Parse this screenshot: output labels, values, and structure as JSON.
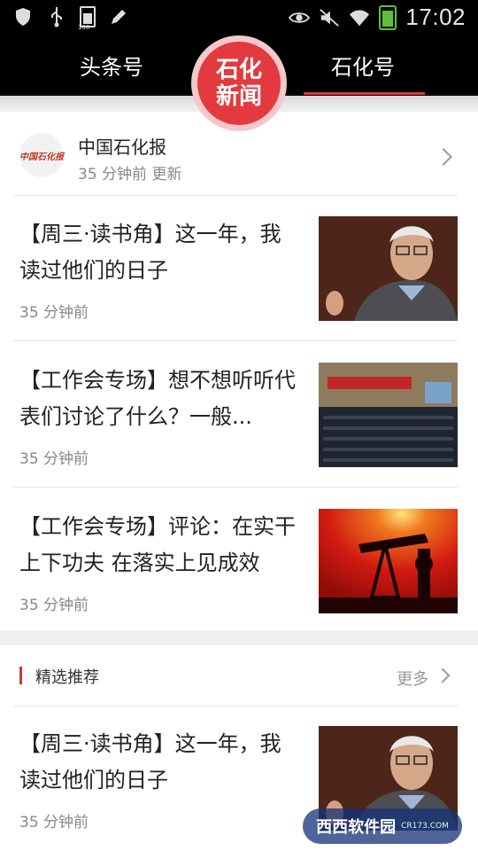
{
  "status_bar": {
    "time": "17:02",
    "battery_label": "100",
    "icons": [
      "shield-icon",
      "usb-icon",
      "battery-icon",
      "pen-icon",
      "eye-icon",
      "mute-icon",
      "signal-icon",
      "wifi-icon",
      "battery-charging-icon"
    ]
  },
  "top_tabs": {
    "left_label": "头条号",
    "right_label": "石化号",
    "active": "石化号",
    "logo_line1": "石化",
    "logo_line2": "新闻"
  },
  "source": {
    "logo_text": "中国石化报",
    "name": "中国石化报",
    "updated": "35 分钟前 更新"
  },
  "news": [
    {
      "title": "【周三·读书角】这一年，我读过他们的日子",
      "time": "35 分钟前",
      "thumb": "portrait-elderly-man"
    },
    {
      "title": "【工作会专场】想不想听听代表们讨论了什么？一般...",
      "time": "35 分钟前",
      "thumb": "conference-hall"
    },
    {
      "title": "【工作会专场】评论：在实干上下功夫 在落实上见成效",
      "time": "35 分钟前",
      "thumb": "oil-pump-sunset"
    }
  ],
  "featured": {
    "section_title": "精选推荐",
    "more_label": "更多",
    "items": [
      {
        "title": "【周三·读书角】这一年，我读过他们的日子",
        "time": "35 分钟前",
        "thumb": "portrait-elderly-man"
      }
    ]
  },
  "watermark": {
    "text": "西西软件园",
    "sub": "CR173.COM"
  },
  "colors": {
    "accent": "#e0353b",
    "topbar": "#000000",
    "background": "#efefef"
  }
}
